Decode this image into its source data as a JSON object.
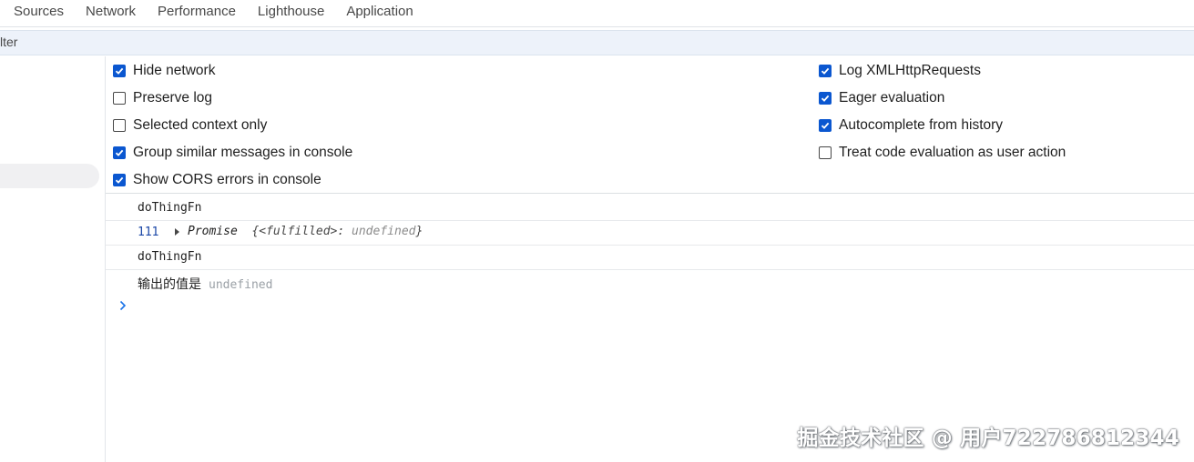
{
  "tabs": [
    "Sources",
    "Network",
    "Performance",
    "Lighthouse",
    "Application"
  ],
  "filter": {
    "text": "lter"
  },
  "settings": {
    "left": [
      {
        "label": "Hide network",
        "checked": true
      },
      {
        "label": "Preserve log",
        "checked": false
      },
      {
        "label": "Selected context only",
        "checked": false
      },
      {
        "label": "Group similar messages in console",
        "checked": true
      },
      {
        "label": "Show CORS errors in console",
        "checked": true
      }
    ],
    "right": [
      {
        "label": "Log XMLHttpRequests",
        "checked": true
      },
      {
        "label": "Eager evaluation",
        "checked": true
      },
      {
        "label": "Autocomplete from history",
        "checked": true
      },
      {
        "label": "Treat code evaluation as user action",
        "checked": false
      }
    ]
  },
  "console": {
    "messages": [
      {
        "text": "doThingFn"
      },
      {
        "line": "111",
        "promise_keyword": "Promise",
        "promise_state": "{<fulfilled>: ",
        "promise_value": "undefined",
        "promise_close": "}"
      },
      {
        "text": "doThingFn"
      },
      {
        "text": "输出的值是",
        "value": "undefined"
      }
    ]
  },
  "watermark": "掘金技术社区 @ 用户722786812344",
  "colors": {
    "accent": "#0b57d0",
    "filter_bg": "#edf2fa",
    "prompt": "#1a73e8"
  }
}
